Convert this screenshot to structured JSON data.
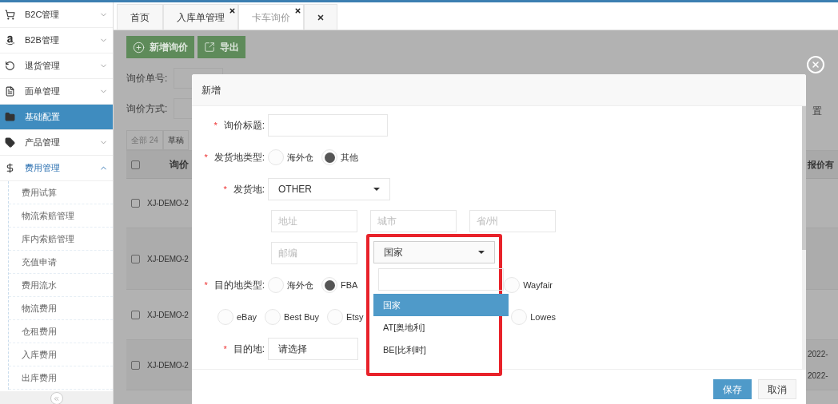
{
  "sidebar": {
    "items": [
      {
        "label": "B2C管理",
        "selected": false,
        "expanded": false
      },
      {
        "label": "B2B管理",
        "selected": false,
        "expanded": false
      },
      {
        "label": "退货管理",
        "selected": false,
        "expanded": false
      },
      {
        "label": "面单管理",
        "selected": false,
        "expanded": false
      },
      {
        "label": "基础配置",
        "selected": true,
        "expanded": false
      },
      {
        "label": "产品管理",
        "selected": false,
        "expanded": false
      },
      {
        "label": "费用管理",
        "selected": false,
        "expanded": true,
        "children": [
          {
            "label": "费用试算"
          },
          {
            "label": "物流索赔管理"
          },
          {
            "label": "库内索赔管理"
          },
          {
            "label": "充值申请"
          },
          {
            "label": "费用流水"
          },
          {
            "label": "物流费用"
          },
          {
            "label": "仓租费用"
          },
          {
            "label": "入库费用"
          },
          {
            "label": "出库费用"
          }
        ]
      }
    ]
  },
  "tab_bar": {
    "tabs": [
      {
        "label": "首页",
        "selected": false,
        "closable": false
      },
      {
        "label": "入库单管理",
        "selected": false,
        "closable": true
      },
      {
        "label": "卡车询价",
        "selected": true,
        "closable": true
      }
    ],
    "close_all": true
  },
  "toolbar": {
    "buttons": [
      "新增询价",
      "导出"
    ]
  },
  "filters": [
    {
      "label": "询价单号:"
    },
    {
      "label": "询价方式:"
    }
  ],
  "reset_button": "置",
  "status_tabs": [
    "全部 24",
    "草稿"
  ],
  "table": {
    "columns": [
      "询价",
      "报价有"
    ],
    "header_checked": false,
    "rows": [
      {
        "column_1": "XJ-DEMO-2",
        "checked": false,
        "column_2": []
      },
      {
        "column_1": "XJ-DEMO-2",
        "checked": false,
        "column_2": []
      },
      {
        "column_1": "XJ-DEMO-2",
        "checked": false,
        "column_2": []
      },
      {
        "column_1": "XJ-DEMO-2",
        "checked": false,
        "column_2": [
          "2022-",
          "2022-"
        ]
      }
    ]
  },
  "dialog": {
    "title": "新增",
    "fields": [
      {
        "kind": "text",
        "label": "询价标题:",
        "required_mark": "*"
      },
      {
        "kind": "radio",
        "label": "发货地类型:",
        "required_mark": "*",
        "options": [
          {
            "label": "海外仓",
            "selected": false
          },
          {
            "label": "其他",
            "selected": true
          }
        ]
      },
      {
        "kind": "select",
        "label": "发货地:",
        "required_mark": "*",
        "value": "OTHER"
      },
      {
        "kind": "inputs",
        "placeholders": [
          "地址",
          "城市",
          "省/州"
        ]
      },
      {
        "kind": "inputs",
        "placeholders": [
          "邮编"
        ]
      },
      {
        "kind": "radio",
        "label": "目的地类型:",
        "required_mark": "*",
        "options": [
          {
            "label": "海外仓",
            "selected": false
          },
          {
            "label": "FBA",
            "selected": true
          },
          {
            "label": "Wayfair",
            "selected": false
          }
        ]
      },
      {
        "kind": "radio",
        "options": [
          {
            "label": "eBay",
            "selected": false
          },
          {
            "label": "Best Buy",
            "selected": false
          },
          {
            "label": "Etsy",
            "selected": false
          },
          {
            "label": "Lowes",
            "selected": false
          }
        ]
      },
      {
        "kind": "select",
        "label": "目的地:",
        "required_mark": "*",
        "value": "请选择"
      }
    ],
    "country_select": {
      "value": "国家",
      "open": true,
      "highlighted": true,
      "options": [
        {
          "label": "国家",
          "selected": true
        },
        {
          "label": "AT[奥地利]",
          "selected": false
        },
        {
          "label": "BE[比利时]",
          "selected": false
        }
      ]
    },
    "buttons": [
      {
        "label": "保存",
        "kind": "primary"
      },
      {
        "label": "取消",
        "kind": "secondary"
      }
    ]
  }
}
